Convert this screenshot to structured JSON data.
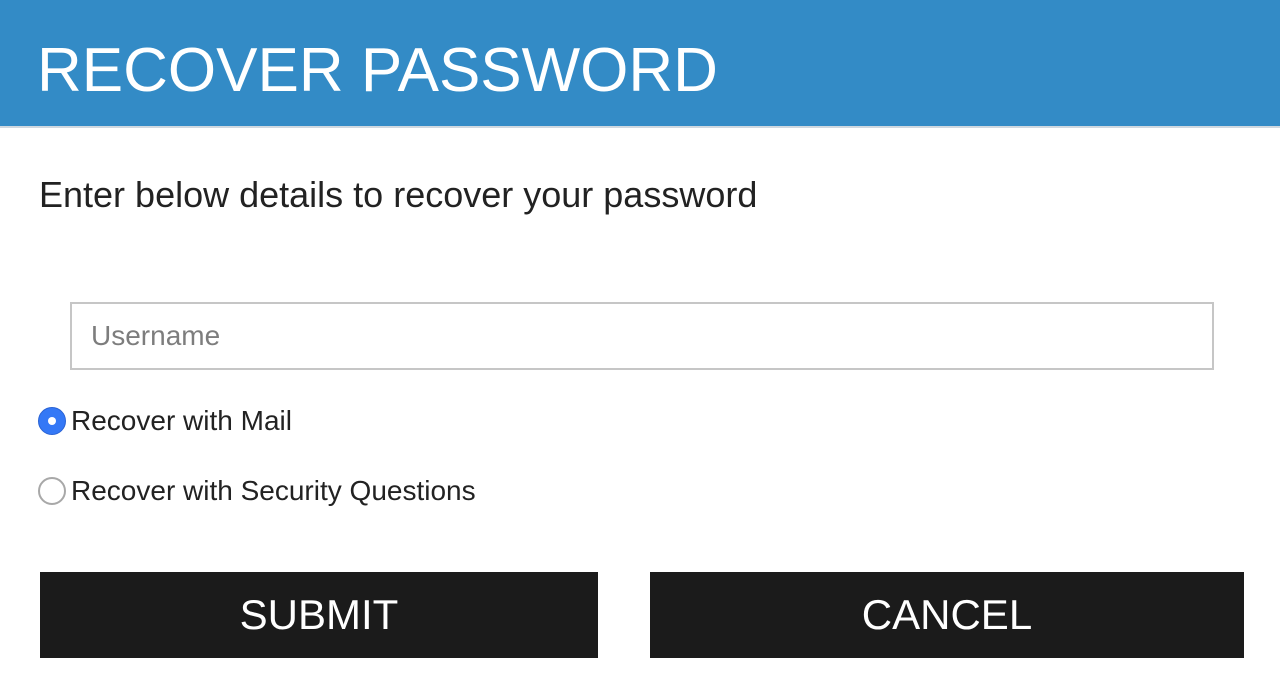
{
  "header": {
    "title": "RECOVER PASSWORD"
  },
  "form": {
    "instructions": "Enter below details to recover your password",
    "username": {
      "value": "",
      "placeholder": "Username"
    },
    "recovery_options": [
      {
        "label": "Recover with Mail",
        "selected": true
      },
      {
        "label": "Recover with Security Questions",
        "selected": false
      }
    ],
    "submit_label": "SUBMIT",
    "cancel_label": "CANCEL"
  },
  "colors": {
    "header_bg": "#338bc6",
    "button_bg": "#1b1b1b",
    "radio_selected": "#3478f6"
  }
}
